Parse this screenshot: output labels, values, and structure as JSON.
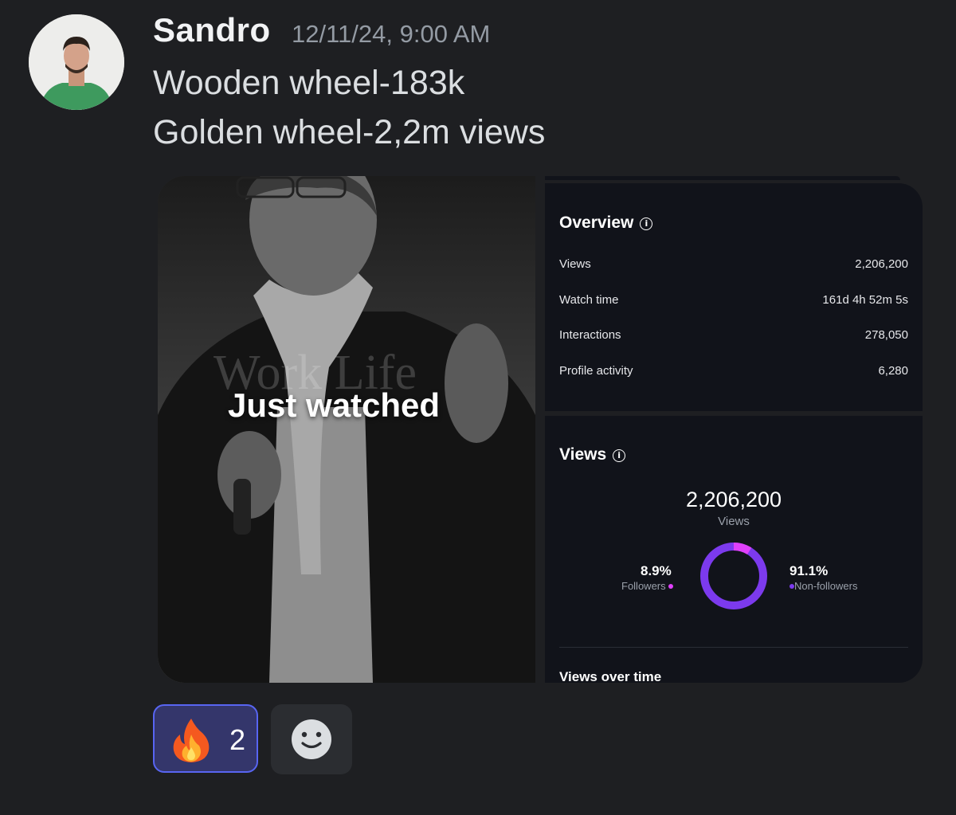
{
  "message": {
    "author": "Sandro",
    "timestamp": "12/11/24, 9:00 AM",
    "lines": [
      "Wooden wheel-183k",
      "Golden wheel-2,2m views"
    ]
  },
  "attachment": {
    "video": {
      "watermark": "Work Life",
      "overlay_text": "Just watched"
    },
    "overview": {
      "title": "Overview",
      "rows": [
        {
          "label": "Views",
          "value": "2,206,200"
        },
        {
          "label": "Watch time",
          "value": "161d 4h 52m 5s"
        },
        {
          "label": "Interactions",
          "value": "278,050"
        },
        {
          "label": "Profile activity",
          "value": "6,280"
        }
      ]
    },
    "views": {
      "title": "Views",
      "total": "2,206,200",
      "total_label": "Views",
      "followers_pct": "8.9%",
      "followers_label": "Followers",
      "non_followers_pct": "91.1%",
      "non_followers_label": "Non-followers",
      "followers_fraction": 0.089,
      "section_below": "Views over time",
      "colors": {
        "followers": "#e040fb",
        "non_followers": "#7c3aed"
      }
    }
  },
  "reactions": [
    {
      "emoji": "fire-icon",
      "count": "2",
      "selected": true
    }
  ]
}
